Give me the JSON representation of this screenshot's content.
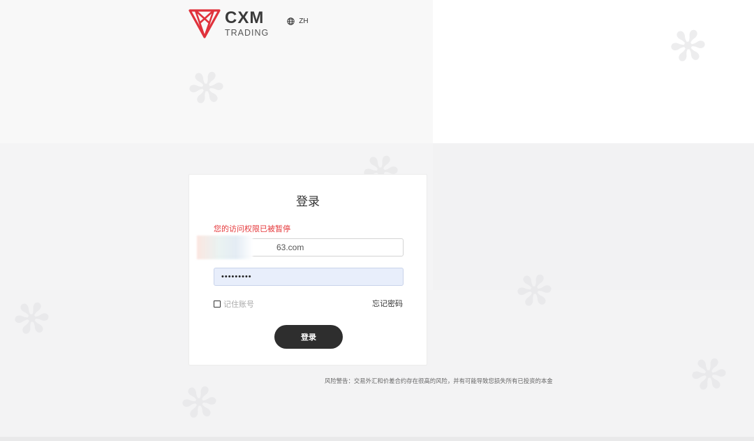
{
  "brand": {
    "name": "CXM",
    "subtitle": "TRADING",
    "accent_color": "#e0323c"
  },
  "language": {
    "icon": "globe-icon",
    "label": "ZH"
  },
  "login": {
    "title": "登录",
    "error": "您的访问权限已被暂停",
    "email_visible_suffix": "63.com",
    "password_mask": "•••••••••",
    "remember_label": "记住账号",
    "remember_checked": false,
    "forgot_label": "忘记密码",
    "submit_label": "登录",
    "error_color": "#e5383b",
    "button_color": "#2e2e2e"
  },
  "footer": {
    "risk_warning": "风险警告：交易外汇和价差合约存在很高的风险，并有可能导致您损失所有已投资的本金"
  }
}
